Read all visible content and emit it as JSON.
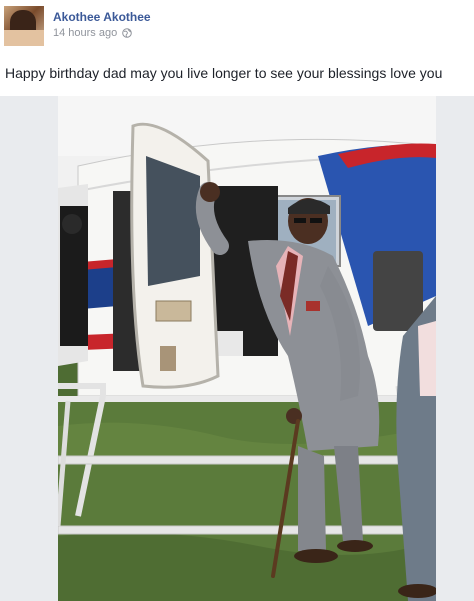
{
  "post": {
    "author_name": "Akothee Akothee",
    "timestamp": "14 hours ago",
    "privacy_icon": "globe-icon",
    "text": "Happy birthday dad may you live longer to see your blessings love you"
  },
  "photo": {
    "subject": "photo",
    "colors": {
      "sky": "#f2f2f2",
      "grass": "#5a7a3a",
      "helicopter_white": "#f7f7f5",
      "helicopter_blue": "#1c3f8a",
      "helicopter_red": "#c8252b",
      "suit": "#8d9096"
    }
  },
  "colors": {
    "brand_link": "#3b5998",
    "muted_text": "#90949c",
    "body_text": "#1d2129",
    "feed_bg": "#e9ebee"
  }
}
